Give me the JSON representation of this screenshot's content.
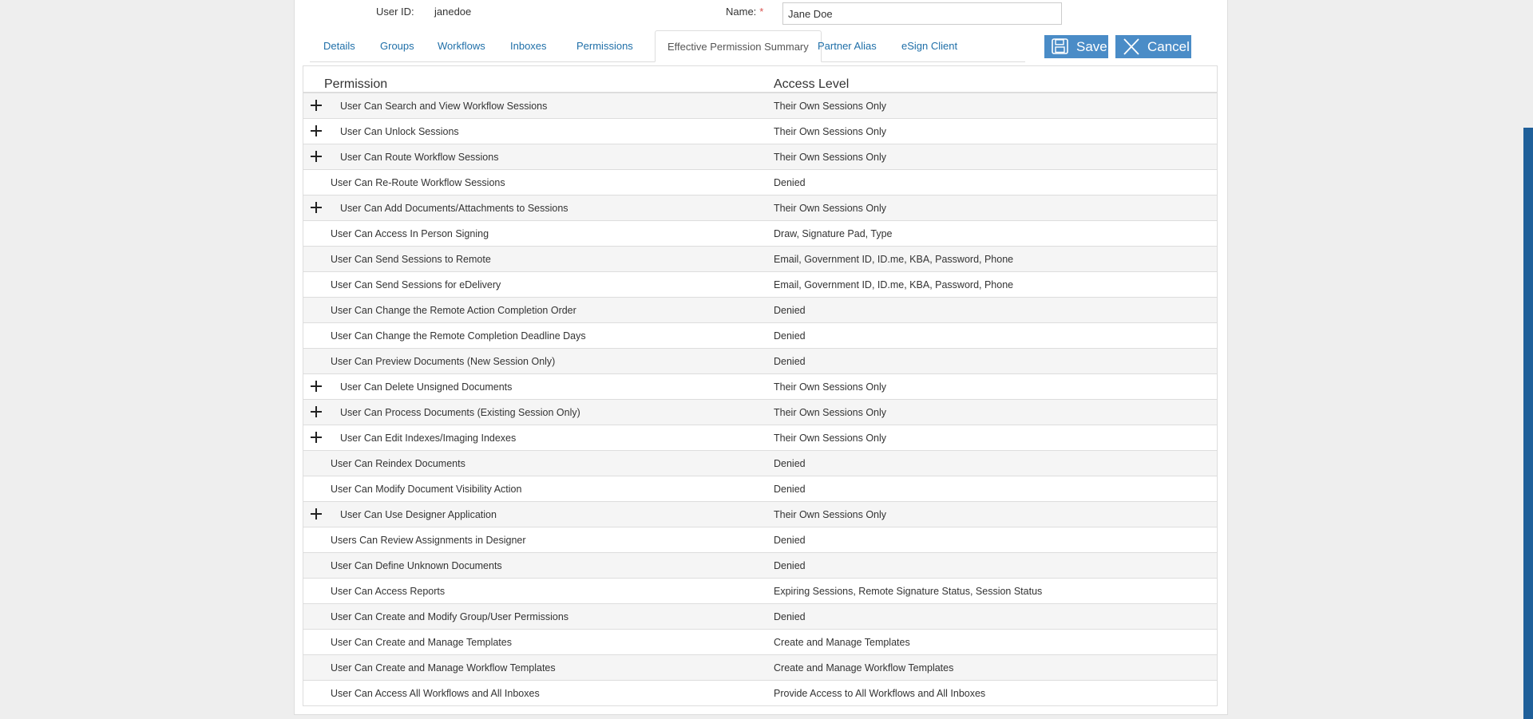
{
  "header": {
    "user_id_label": "User ID:",
    "user_id_value": "janedoe",
    "name_label": "Name:",
    "name_required": "*",
    "name_value": "Jane Doe"
  },
  "tabs": [
    {
      "label": "Details"
    },
    {
      "label": "Groups"
    },
    {
      "label": "Workflows"
    },
    {
      "label": "Inboxes"
    },
    {
      "label": "Permissions"
    },
    {
      "label": "Effective Permission Summary",
      "active": true
    },
    {
      "label": "Partner Alias"
    },
    {
      "label": "eSign Client"
    }
  ],
  "actions": {
    "save_label": "Save",
    "cancel_label": "Cancel",
    "save_icon": "floppy-disk-icon",
    "cancel_icon": "close-x-icon"
  },
  "table": {
    "col_permission": "Permission",
    "col_access": "Access Level",
    "rows": [
      {
        "permission": "User Can Search and View Workflow Sessions",
        "access": "Their Own Sessions Only",
        "expandable": true
      },
      {
        "permission": "User Can Unlock Sessions",
        "access": "Their Own Sessions Only",
        "expandable": true
      },
      {
        "permission": "User Can Route Workflow Sessions",
        "access": "Their Own Sessions Only",
        "expandable": true
      },
      {
        "permission": "User Can Re-Route Workflow Sessions",
        "access": "Denied",
        "expandable": false
      },
      {
        "permission": "User Can Add Documents/Attachments to Sessions",
        "access": "Their Own Sessions Only",
        "expandable": true
      },
      {
        "permission": "User Can Access In Person Signing",
        "access": "Draw, Signature Pad, Type",
        "expandable": false
      },
      {
        "permission": "User Can Send Sessions to Remote",
        "access": "Email, Government ID, ID.me, KBA, Password, Phone",
        "expandable": false
      },
      {
        "permission": "User Can Send Sessions for eDelivery",
        "access": "Email, Government ID, ID.me, KBA, Password, Phone",
        "expandable": false
      },
      {
        "permission": "User Can Change the Remote Action Completion Order",
        "access": "Denied",
        "expandable": false
      },
      {
        "permission": "User Can Change the Remote Completion Deadline Days",
        "access": "Denied",
        "expandable": false
      },
      {
        "permission": "User Can Preview Documents (New Session Only)",
        "access": "Denied",
        "expandable": false
      },
      {
        "permission": "User Can Delete Unsigned Documents",
        "access": "Their Own Sessions Only",
        "expandable": true
      },
      {
        "permission": "User Can Process Documents (Existing Session Only)",
        "access": "Their Own Sessions Only",
        "expandable": true
      },
      {
        "permission": "User Can Edit Indexes/Imaging Indexes",
        "access": "Their Own Sessions Only",
        "expandable": true
      },
      {
        "permission": "User Can Reindex Documents",
        "access": "Denied",
        "expandable": false
      },
      {
        "permission": "User Can Modify Document Visibility Action",
        "access": "Denied",
        "expandable": false
      },
      {
        "permission": "User Can Use Designer Application",
        "access": "Their Own Sessions Only",
        "expandable": true
      },
      {
        "permission": "Users Can Review Assignments in Designer",
        "access": "Denied",
        "expandable": false
      },
      {
        "permission": "User Can Define Unknown Documents",
        "access": "Denied",
        "expandable": false
      },
      {
        "permission": "User Can Access Reports",
        "access": "Expiring Sessions, Remote Signature Status, Session Status",
        "expandable": false
      },
      {
        "permission": "User Can Create and Modify Group/User Permissions",
        "access": "Denied",
        "expandable": false
      },
      {
        "permission": "User Can Create and Manage Templates",
        "access": "Create and Manage Templates",
        "expandable": false
      },
      {
        "permission": "User Can Create and Manage Workflow Templates",
        "access": "Create and Manage Workflow Templates",
        "expandable": false
      },
      {
        "permission": "User Can Access All Workflows and All Inboxes",
        "access": "Provide Access to All Workflows and All Inboxes",
        "expandable": false
      }
    ]
  }
}
